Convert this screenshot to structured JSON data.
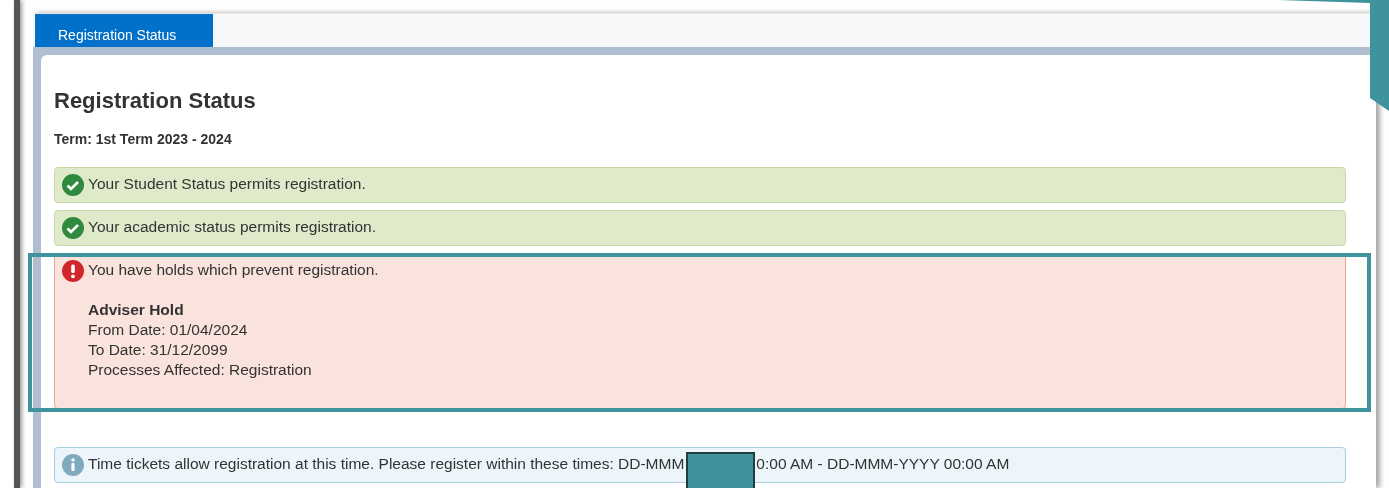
{
  "tabs": [
    {
      "label": "Registration Status",
      "selected": true
    }
  ],
  "heading": "Registration Status",
  "term": "Term: 1st Term 2023 - 2024",
  "messages": [
    {
      "kind": "success",
      "text": "Your Student Status permits registration."
    },
    {
      "kind": "success",
      "text": "Your academic status permits registration."
    },
    {
      "kind": "error",
      "text": "You have holds which prevent registration.",
      "details": {
        "title": "Adviser Hold",
        "lines": [
          "From Date: 01/04/2024",
          "To Date: 31/12/2099",
          "Processes Affected: Registration"
        ]
      }
    },
    {
      "kind": "info",
      "text": "Time tickets allow registration at this time. Please register within these times: DD-MMM",
      "text_after": "0:00 AM - DD-MMM-YYYY 00:00 AM"
    }
  ]
}
